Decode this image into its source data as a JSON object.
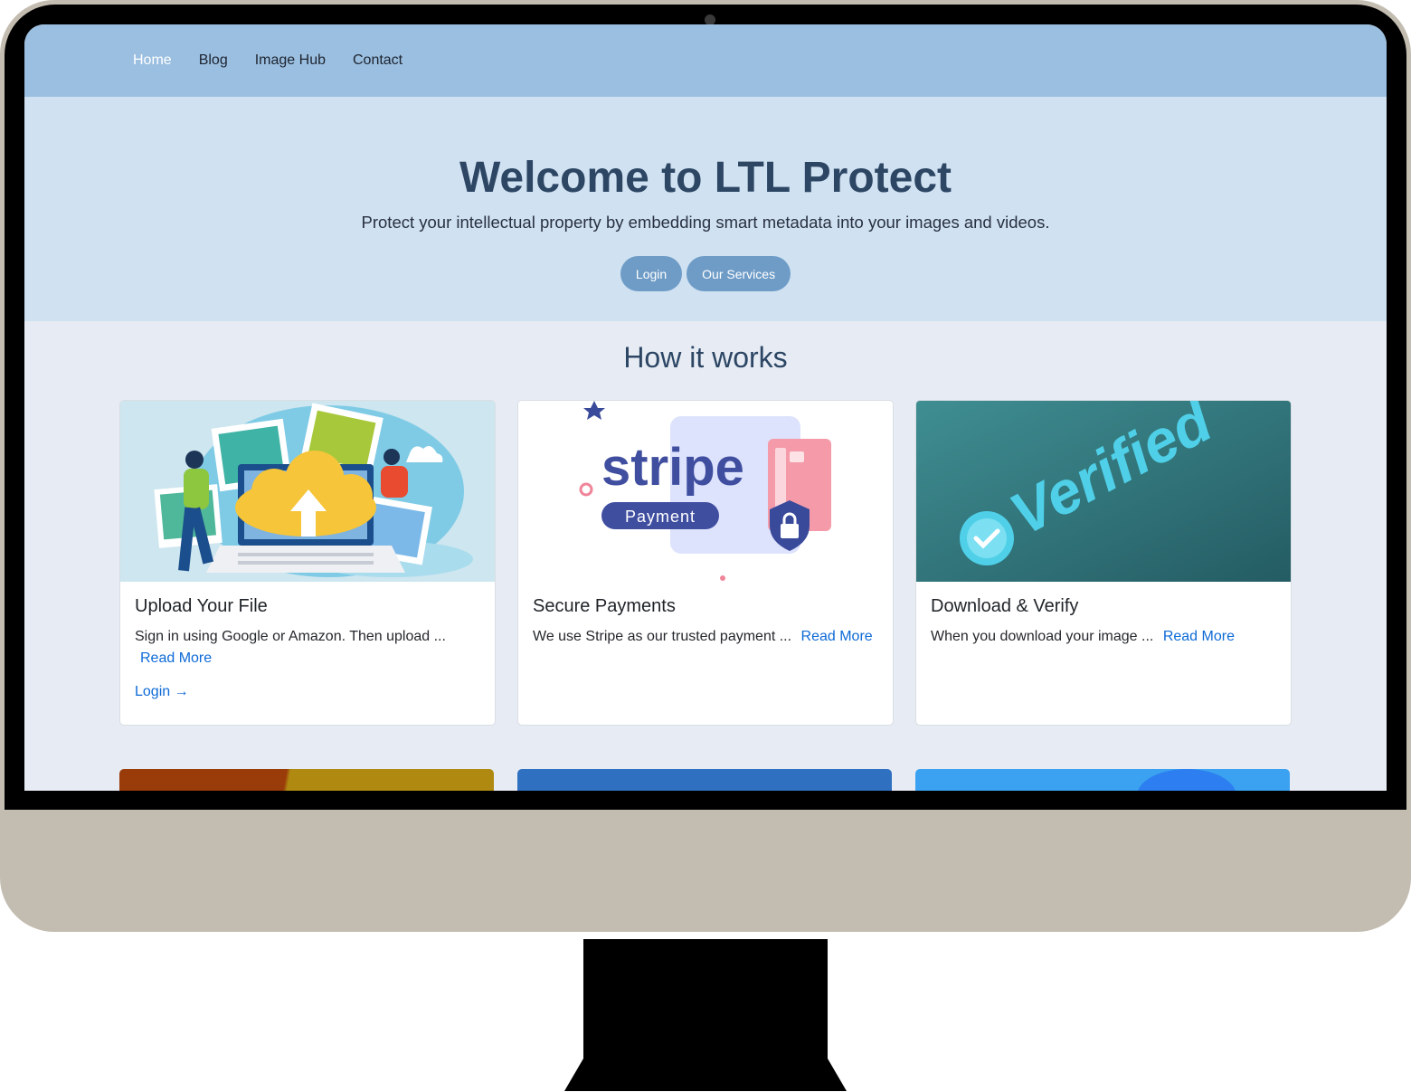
{
  "nav": {
    "items": [
      {
        "label": "Home",
        "active": true
      },
      {
        "label": "Blog",
        "active": false
      },
      {
        "label": "Image Hub",
        "active": false
      },
      {
        "label": "Contact",
        "active": false
      }
    ]
  },
  "hero": {
    "title": "Welcome to LTL Protect",
    "subtitle": "Protect your intellectual property by embedding smart metadata into your images and videos.",
    "login_label": "Login",
    "services_label": "Our Services"
  },
  "how_it_works": {
    "title": "How it works",
    "read_more_label": "Read More",
    "cards": [
      {
        "title": "Upload Your File",
        "text": "Sign in using Google or Amazon. Then upload ...",
        "link": "Login →",
        "image": "upload-cloud-illustration"
      },
      {
        "title": "Secure Payments",
        "text": "We use Stripe as our trusted payment ...",
        "image": "stripe-payment-illustration",
        "image_text": {
          "brand": "stripe",
          "badge": "Payment"
        }
      },
      {
        "title": "Download & Verify",
        "text": "When you download your image ...",
        "image": "verified-3d-illustration",
        "image_text": {
          "word": "Verified"
        }
      }
    ]
  },
  "colors": {
    "nav_bg": "#9bbfe0",
    "hero_bg": "#d0e1f1",
    "section_bg": "#e7ecf4",
    "title_color": "#2c4664",
    "button_bg": "#6e9cc7",
    "link_color": "#0d6ad6"
  }
}
